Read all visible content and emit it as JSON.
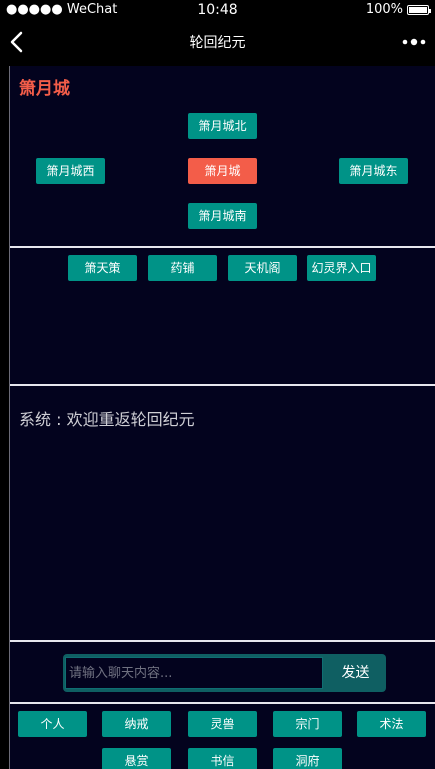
{
  "status_bar": {
    "carrier": "●●●●● WeChat",
    "time": "10:48",
    "battery": "100%"
  },
  "nav": {
    "title": "轮回纪元"
  },
  "city": {
    "title": "箫月城",
    "north": "箫月城北",
    "west": "箫月城西",
    "center": "箫月城",
    "east": "箫月城东",
    "south": "箫月城南"
  },
  "places": [
    "箫天策",
    "药铺",
    "天机阁",
    "幻灵界入口"
  ],
  "chat": {
    "message": "系统 : 欢迎重返轮回纪元",
    "placeholder": "请输入聊天内容...",
    "send_label": "发送"
  },
  "menu": {
    "row1": [
      "个人",
      "纳戒",
      "灵兽",
      "宗门",
      "术法"
    ],
    "row2": [
      "悬赏",
      "书信",
      "洞府"
    ]
  },
  "colors": {
    "accent": "#009387",
    "active": "#f35d49",
    "background": "#03031e"
  }
}
